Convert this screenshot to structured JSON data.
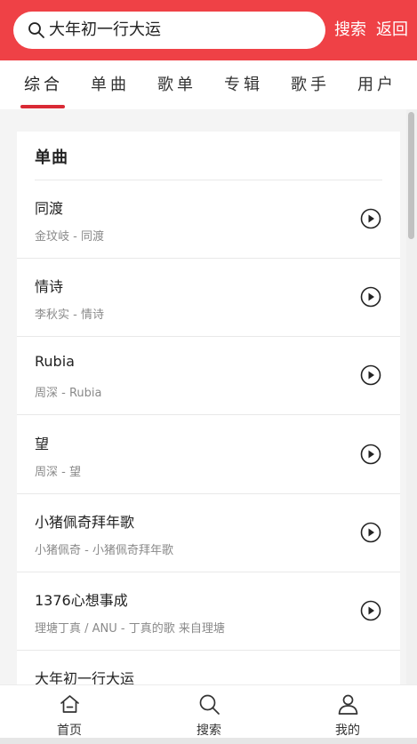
{
  "header": {
    "search_value": "大年初一行大运",
    "search_button": "搜索",
    "back_button": "返回",
    "accent_color": "#ef4146"
  },
  "tabs": [
    {
      "label": "综合",
      "active": true
    },
    {
      "label": "单曲",
      "active": false
    },
    {
      "label": "歌单",
      "active": false
    },
    {
      "label": "专辑",
      "active": false
    },
    {
      "label": "歌手",
      "active": false
    },
    {
      "label": "用户",
      "active": false
    }
  ],
  "section": {
    "title": "单曲",
    "songs": [
      {
        "name": "同渡",
        "sub": "金玟岐 - 同渡"
      },
      {
        "name": "情诗",
        "sub": "李秋实 - 情诗"
      },
      {
        "name": "Rubia",
        "sub": "周深 - Rubia"
      },
      {
        "name": "望",
        "sub": "周深 - 望"
      },
      {
        "name": "小猪佩奇拜年歌",
        "sub": "小猪佩奇 - 小猪佩奇拜年歌"
      },
      {
        "name": "1376心想事成",
        "sub": "理塘丁真 / ANU - 丁真的歌 来自理塘"
      },
      {
        "name": "大年初一行大运",
        "sub": ""
      }
    ]
  },
  "bottom_nav": [
    {
      "label": "首页",
      "icon": "home-icon"
    },
    {
      "label": "搜索",
      "icon": "search-icon"
    },
    {
      "label": "我的",
      "icon": "user-icon"
    }
  ]
}
